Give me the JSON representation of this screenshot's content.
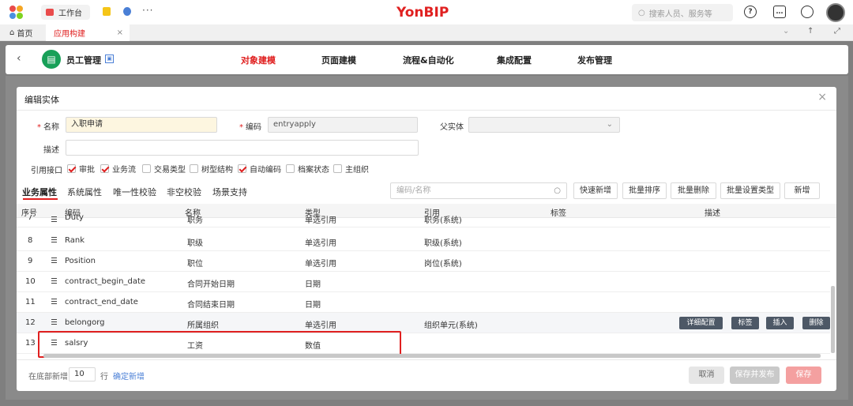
{
  "topbar": {
    "workbench_tab": "工作台",
    "more": "···",
    "brand": "YonBIP",
    "search_placeholder": "搜索人员、服务等"
  },
  "tabs": {
    "home": "首页",
    "app_build": "应用构建",
    "close": "×"
  },
  "app": {
    "name": "员工管理",
    "nav": [
      "对象建模",
      "页面建模",
      "流程&自动化",
      "集成配置",
      "发布管理"
    ],
    "active_nav": "对象建模"
  },
  "dialog": {
    "title": "编辑实体",
    "name_label": "名称",
    "name_value": "入职申请",
    "code_label": "编码",
    "code_value": "entryapply",
    "parent_label": "父实体",
    "desc_label": "描述",
    "interface_label": "引用接口",
    "interfaces": [
      {
        "label": "审批",
        "checked": true
      },
      {
        "label": "业务流",
        "checked": true
      },
      {
        "label": "交易类型",
        "checked": false
      },
      {
        "label": "树型结构",
        "checked": false
      },
      {
        "label": "自动编码",
        "checked": true
      },
      {
        "label": "档案状态",
        "checked": false
      },
      {
        "label": "主组织",
        "checked": false
      }
    ],
    "subtabs": [
      "业务属性",
      "系统属性",
      "唯一性校验",
      "非空校验",
      "场景支持"
    ],
    "search_placeholder": "编码/名称",
    "toolbar": [
      "快速新增",
      "批量排序",
      "批量删除",
      "批量设置类型",
      "新增"
    ],
    "columns": [
      "序号",
      "编码",
      "名称",
      "类型",
      "引用",
      "标签",
      "描述"
    ],
    "rows": [
      {
        "no": "7",
        "code": "Duty",
        "name": "职务",
        "type": "单选引用",
        "ref": "职务(系统)"
      },
      {
        "no": "8",
        "code": "Rank",
        "name": "职级",
        "type": "单选引用",
        "ref": "职级(系统)"
      },
      {
        "no": "9",
        "code": "Position",
        "name": "职位",
        "type": "单选引用",
        "ref": "岗位(系统)"
      },
      {
        "no": "10",
        "code": "contract_begin_date",
        "name": "合同开始日期",
        "type": "日期",
        "ref": ""
      },
      {
        "no": "11",
        "code": "contract_end_date",
        "name": "合同结束日期",
        "type": "日期",
        "ref": ""
      },
      {
        "no": "12",
        "code": "belongorg",
        "name": "所属组织",
        "type": "单选引用",
        "ref": "组织单元(系统)"
      },
      {
        "no": "13",
        "code": "salsry",
        "name": "工资",
        "type": "数值",
        "ref": ""
      }
    ],
    "row_actions": [
      "详细配置",
      "标签",
      "插入",
      "删除"
    ],
    "footer": {
      "add_at_bottom": "在底部新增",
      "count": "10",
      "rows_unit": "行",
      "confirm_add": "确定新增",
      "cancel": "取消",
      "save_publish": "保存并发布",
      "save": "保存"
    }
  },
  "colors": {
    "brand": "#e02020",
    "accent_green": "#18a058"
  }
}
